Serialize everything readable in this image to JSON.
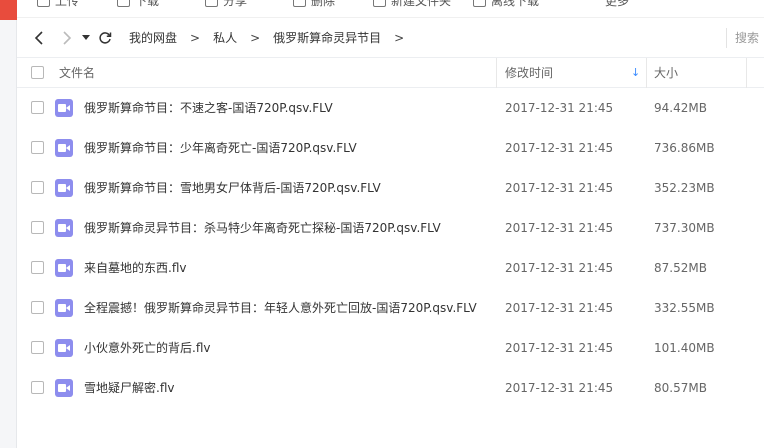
{
  "toolbar": {
    "items": [
      {
        "icon": "upload-icon",
        "label": "上传"
      },
      {
        "icon": "download-icon",
        "label": "下载"
      },
      {
        "icon": "share-icon",
        "label": "分享"
      },
      {
        "icon": "delete-icon",
        "label": "删除"
      },
      {
        "icon": "new-folder-icon",
        "label": "新建文件夹"
      },
      {
        "icon": "offline-download-icon",
        "label": "离线下载"
      },
      {
        "icon": "more-icon",
        "label": "更多"
      }
    ]
  },
  "nav": {
    "breadcrumb": [
      "我的网盘",
      "私人",
      "俄罗斯算命灵异节目"
    ],
    "search_placeholder": "搜索"
  },
  "table": {
    "columns": {
      "name": "文件名",
      "modified": "修改时间",
      "size": "大小"
    },
    "sort_indicator": "↓",
    "rows": [
      {
        "name": "俄罗斯算命节目：不速之客-国语720P.qsv.FLV",
        "modified": "2017-12-31 21:45",
        "size": "94.42MB"
      },
      {
        "name": "俄罗斯算命节目：少年离奇死亡-国语720P.qsv.FLV",
        "modified": "2017-12-31 21:45",
        "size": "736.86MB"
      },
      {
        "name": "俄罗斯算命节目：雪地男女尸体背后-国语720P.qsv.FLV",
        "modified": "2017-12-31 21:45",
        "size": "352.23MB"
      },
      {
        "name": "俄罗斯算命灵异节目：杀马特少年离奇死亡探秘-国语720P.qsv.FLV",
        "modified": "2017-12-31 21:45",
        "size": "737.30MB"
      },
      {
        "name": "来自墓地的东西.flv",
        "modified": "2017-12-31 21:45",
        "size": "87.52MB"
      },
      {
        "name": "全程震撼！俄罗斯算命灵异节目：年轻人意外死亡回放-国语720P.qsv.FLV",
        "modified": "2017-12-31 21:45",
        "size": "332.55MB"
      },
      {
        "name": "小伙意外死亡的背后.flv",
        "modified": "2017-12-31 21:45",
        "size": "101.40MB"
      },
      {
        "name": "雪地疑尸解密.flv",
        "modified": "2017-12-31 21:45",
        "size": "80.57MB"
      }
    ]
  },
  "colors": {
    "video_icon": "#8d8dee",
    "sort_arrow": "#3b8cff",
    "accent_red": "#e84c3d"
  }
}
